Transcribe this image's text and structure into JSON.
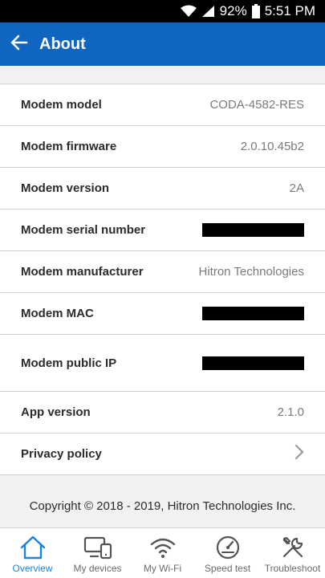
{
  "status_bar": {
    "battery": "92%",
    "time": "5:51 PM"
  },
  "app_bar": {
    "title": "About"
  },
  "rows": [
    {
      "label": "Modem model",
      "value": "CODA-4582-RES"
    },
    {
      "label": "Modem firmware",
      "value": "2.0.10.45b2"
    },
    {
      "label": "Modem version",
      "value": "2A"
    },
    {
      "label": "Modem serial number",
      "value": ""
    },
    {
      "label": "Modem manufacturer",
      "value": "Hitron Technologies"
    },
    {
      "label": "Modem MAC",
      "value": ""
    },
    {
      "label": "Modem public IP",
      "value": ""
    },
    {
      "label": "App version",
      "value": "2.1.0"
    },
    {
      "label": "Privacy policy",
      "value": ""
    }
  ],
  "footer": {
    "copyright": "Copyright © 2018 - 2019, Hitron Technologies Inc."
  },
  "bottom_nav": [
    {
      "label": "Overview",
      "icon": "home-icon",
      "active": true
    },
    {
      "label": "My devices",
      "icon": "devices-icon",
      "active": false
    },
    {
      "label": "My Wi-Fi",
      "icon": "wifi-icon",
      "active": false
    },
    {
      "label": "Speed test",
      "icon": "speedometer-icon",
      "active": false
    },
    {
      "label": "Troubleshoot",
      "icon": "tools-icon",
      "active": false
    }
  ],
  "colors": {
    "app_bar": "#0f65bf",
    "active_nav": "#1b83d8"
  }
}
